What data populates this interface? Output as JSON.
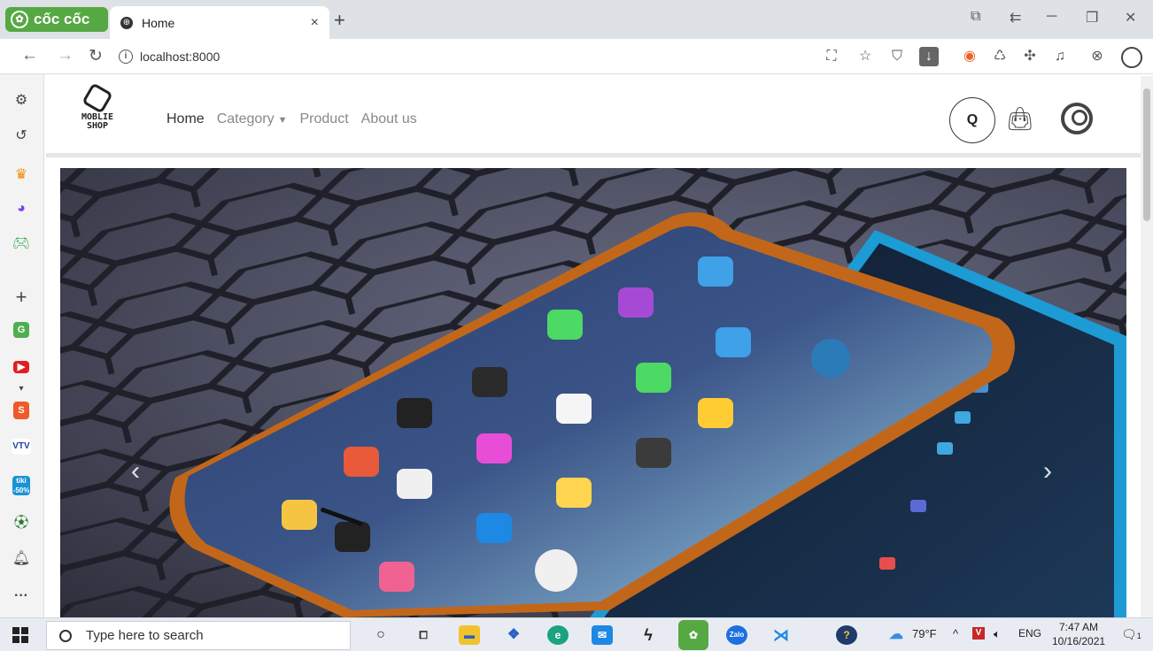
{
  "browser": {
    "brand": "cốc cốc",
    "tab_title": "Home",
    "tab_close": "×",
    "new_tab": "+",
    "url": "localhost:8000"
  },
  "site": {
    "logo_line1": "MOBLIE",
    "logo_line2": "SHOP",
    "menu": [
      "Home",
      "Category",
      "Product",
      "About us"
    ],
    "search_glyph": "Q"
  },
  "carousel": {
    "prev": "‹",
    "next": "›"
  },
  "taskbar": {
    "search_placeholder": "Type here to search",
    "temperature": "79°F",
    "language": "ENG",
    "time": "7:47 AM",
    "date": "10/16/2021",
    "notification_count": "1"
  },
  "colors": {
    "brand_green": "#56a843",
    "hero_bg": "#4b4d60",
    "phone_body": "#1d8fc9",
    "accent_orange": "#f5a623"
  }
}
